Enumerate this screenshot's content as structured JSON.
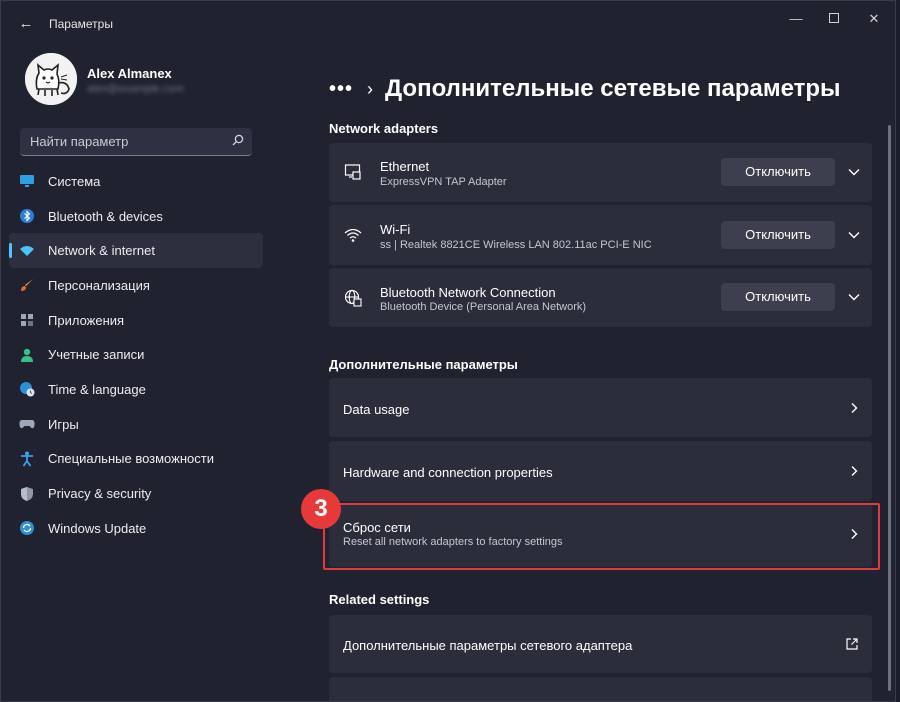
{
  "window": {
    "title": "Параметры"
  },
  "user": {
    "name": "Alex Almanex",
    "email": "alex@example.com"
  },
  "search": {
    "placeholder": "Найти параметр"
  },
  "sidebar": {
    "items": [
      {
        "label": "Система",
        "icon": "monitor-icon"
      },
      {
        "label": "Bluetooth & devices",
        "icon": "bluetooth-icon"
      },
      {
        "label": "Network & internet",
        "icon": "wifi-icon",
        "active": true
      },
      {
        "label": "Персонализация",
        "icon": "brush-icon"
      },
      {
        "label": "Приложения",
        "icon": "apps-icon"
      },
      {
        "label": "Учетные записи",
        "icon": "person-icon"
      },
      {
        "label": "Time & language",
        "icon": "globe-clock-icon"
      },
      {
        "label": "Игры",
        "icon": "gamepad-icon"
      },
      {
        "label": "Специальные возможности",
        "icon": "accessibility-icon"
      },
      {
        "label": "Privacy & security",
        "icon": "shield-icon"
      },
      {
        "label": "Windows Update",
        "icon": "update-icon"
      }
    ]
  },
  "breadcrumb": {
    "more": "•••",
    "chevron": "›",
    "title": "Дополнительные сетевые параметры"
  },
  "sections": {
    "adapters": "Network adapters",
    "more_settings": "Дополнительные параметры",
    "related": "Related settings"
  },
  "adapters": [
    {
      "name": "Ethernet",
      "desc": "ExpressVPN TAP Adapter",
      "button": "Отключить",
      "icon": "ethernet-icon"
    },
    {
      "name": "Wi-Fi",
      "desc": "ss | Realtek 8821CE Wireless LAN 802.11ac PCI-E NIC",
      "button": "Отключить",
      "icon": "wifi-icon"
    },
    {
      "name": "Bluetooth Network Connection",
      "desc": "Bluetooth Device (Personal Area Network)",
      "button": "Отключить",
      "icon": "globe-icon"
    }
  ],
  "more_settings": [
    {
      "title": "Data usage"
    },
    {
      "title": "Hardware and connection properties"
    },
    {
      "title": "Сброс сети",
      "desc": "Reset all network adapters to factory settings"
    }
  ],
  "related": [
    {
      "title": "Дополнительные параметры сетевого адаптера"
    }
  ],
  "annotation": {
    "step": "3",
    "color": "#e8393a"
  },
  "colors": {
    "accent": "#4cc2ff",
    "background": "#202230",
    "card": "#2b2d3b",
    "highlight": "#e0393f"
  }
}
